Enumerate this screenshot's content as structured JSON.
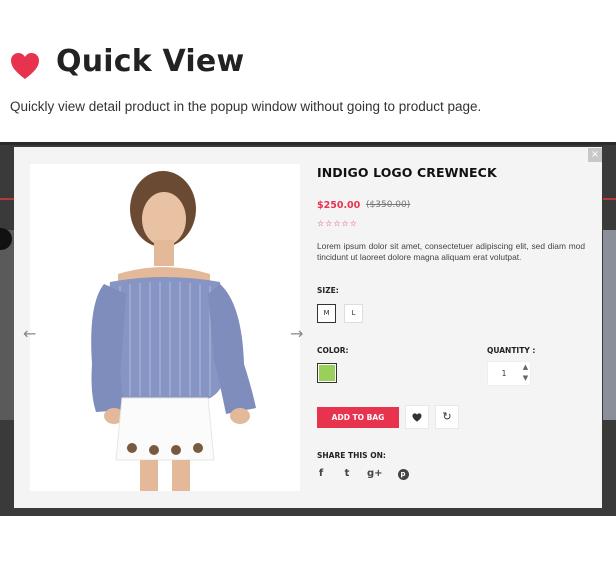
{
  "hero": {
    "title": "Quick View",
    "subtitle": "Quickly view detail product in the popup window without going to product page.",
    "icon": "heart-icon",
    "accent": "#e8334f"
  },
  "modal": {
    "close_label": "×",
    "nav_prev_icon": "arrow-left-icon",
    "nav_next_icon": "arrow-right-icon",
    "product": {
      "title": "INDIGO LOGO CREWNECK",
      "price": "$250.00",
      "old_price": "($350.00)",
      "rating": 0,
      "rating_max": 5,
      "stars": "☆☆☆☆☆",
      "description": "Lorem ipsum dolor sit amet, consectetuer adipiscing elit, sed diam  mod tincidunt ut laoreet dolore magna aliquam erat volutpat."
    },
    "size": {
      "label": "SIZE:",
      "options": [
        "M",
        "L"
      ],
      "selected": "M"
    },
    "color": {
      "label": "COLOR:",
      "swatch": "#98d059"
    },
    "quantity": {
      "label": "QUANTITY :",
      "value": "1",
      "up": "▲",
      "down": "▼"
    },
    "actions": {
      "add_to_bag": "ADD TO BAG",
      "wishlist_icon": "heart-icon",
      "compare_icon": "refresh-icon"
    },
    "share": {
      "label": "SHARE THIS ON:",
      "facebook": "f",
      "twitter": "t",
      "googleplus": "g+",
      "pinterest": "p"
    }
  }
}
